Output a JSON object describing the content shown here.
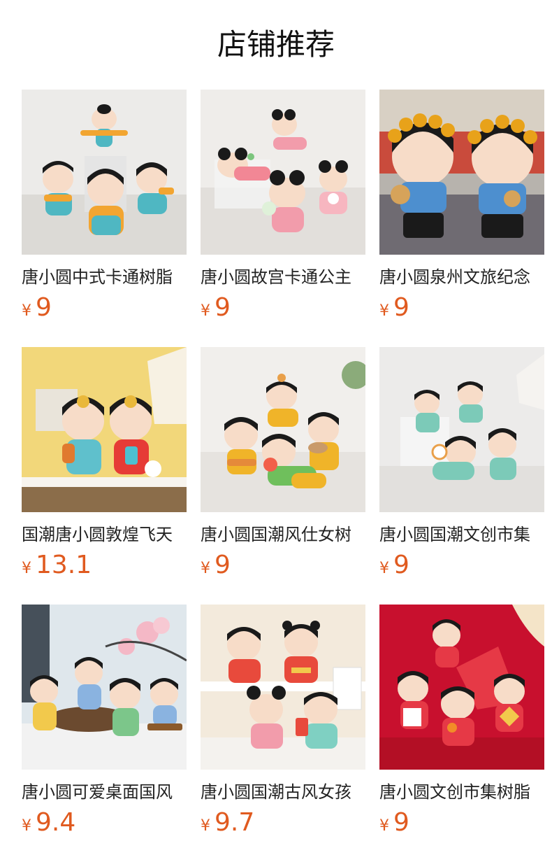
{
  "section": {
    "title": "店铺推荐"
  },
  "products": [
    {
      "name": "唐小圆中式卡通树脂",
      "currency": "¥",
      "price": "9"
    },
    {
      "name": "唐小圆故宫卡通公主",
      "currency": "¥",
      "price": "9"
    },
    {
      "name": "唐小圆泉州文旅纪念",
      "currency": "¥",
      "price": "9"
    },
    {
      "name": "国潮唐小圆敦煌飞天",
      "currency": "¥",
      "price": "13.1"
    },
    {
      "name": "唐小圆国潮风仕女树",
      "currency": "¥",
      "price": "9"
    },
    {
      "name": "唐小圆国潮文创市集",
      "currency": "¥",
      "price": "9"
    },
    {
      "name": "唐小圆可爱桌面国风",
      "currency": "¥",
      "price": "9.4"
    },
    {
      "name": "唐小圆国潮古风女孩",
      "currency": "¥",
      "price": "9.7"
    },
    {
      "name": "唐小圆文创市集树脂",
      "currency": "¥",
      "price": "9"
    }
  ],
  "colors": {
    "price": "#e05a1f",
    "text": "#222222"
  }
}
